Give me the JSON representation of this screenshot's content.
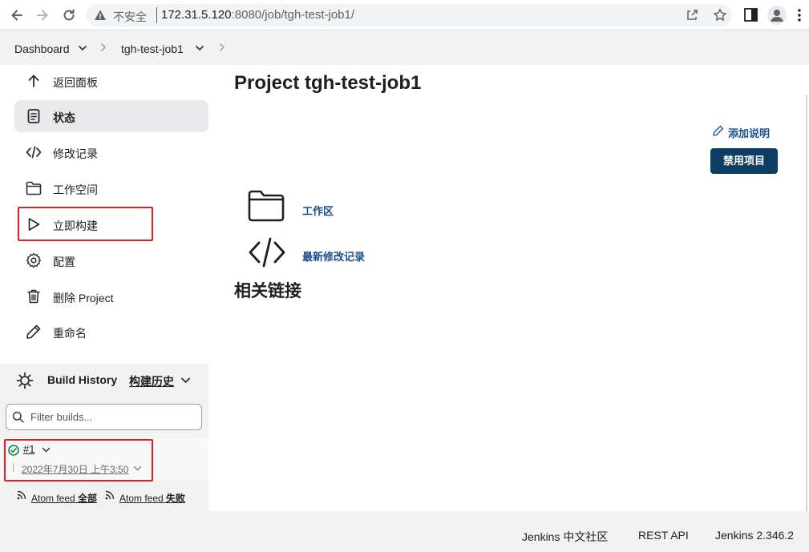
{
  "browser": {
    "insecure_label": "不安全",
    "url_host": "172.31.5.120",
    "url_rest": ":8080/job/tgh-test-job1/"
  },
  "breadcrumb": {
    "items": [
      "Dashboard",
      "tgh-test-job1"
    ]
  },
  "sidebar": {
    "items": [
      {
        "label": "返回面板",
        "icon": "arrow-up-icon"
      },
      {
        "label": "状态",
        "icon": "document-icon"
      },
      {
        "label": "修改记录",
        "icon": "code-icon"
      },
      {
        "label": "工作空间",
        "icon": "folder-icon"
      },
      {
        "label": "立即构建",
        "icon": "play-icon"
      },
      {
        "label": "配置",
        "icon": "gear-icon"
      },
      {
        "label": "删除 Project",
        "icon": "trash-icon"
      },
      {
        "label": "重命名",
        "icon": "pencil-icon"
      }
    ],
    "active_index": 1
  },
  "build_history": {
    "title": "Build History",
    "title_cn": "构建历史",
    "filter_placeholder": "Filter builds...",
    "builds": [
      {
        "number": "#1",
        "date": "2022年7月30日 上午3:50",
        "status": "success"
      }
    ],
    "feeds": [
      {
        "prefix": "Atom feed",
        "label": "全部"
      },
      {
        "prefix": "Atom feed",
        "label": "失败"
      }
    ]
  },
  "main": {
    "title": "Project tgh-test-job1",
    "add_description": "添加说明",
    "disable_button": "禁用项目",
    "links": [
      {
        "label": "工作区",
        "icon": "folder-icon"
      },
      {
        "label": "最新修改记录",
        "icon": "code-icon"
      }
    ],
    "related_heading": "相关链接"
  },
  "footer": {
    "community": "Jenkins 中文社区",
    "rest_api": "REST API",
    "version": "Jenkins 2.346.2"
  },
  "colors": {
    "link": "#1b4f8c",
    "primary_button": "#0d3d63",
    "success": "#138347",
    "highlight": "#e02020"
  }
}
